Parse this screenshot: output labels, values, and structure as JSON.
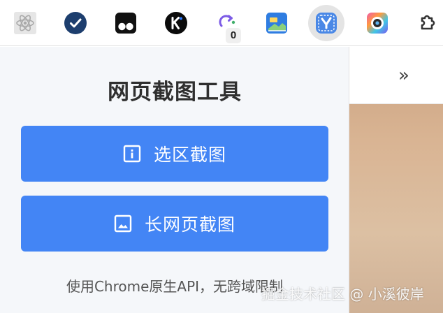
{
  "toolbar": {
    "extensions": [
      {
        "name": "react-devtools",
        "icon": "react-icon"
      },
      {
        "name": "ticktick",
        "icon": "checkmark-circle-icon"
      },
      {
        "name": "tampermonkey",
        "icon": "tampermonkey-icon"
      },
      {
        "name": "kimi",
        "icon": "kimi-k-icon"
      },
      {
        "name": "redirect",
        "icon": "redirect-arrows-icon",
        "badge": "0"
      },
      {
        "name": "image-extension",
        "icon": "landscape-icon"
      },
      {
        "name": "web-screenshot",
        "icon": "screenshot-tool-icon",
        "active": true
      },
      {
        "name": "color-picker",
        "icon": "camera-lens-icon"
      },
      {
        "name": "extensions-menu",
        "icon": "puzzle-icon"
      }
    ]
  },
  "popup": {
    "title": "网页截图工具",
    "region_button_label": "选区截图",
    "long_button_label": "长网页截图",
    "footnote": "使用Chrome原生API，无跨域限制"
  },
  "overflow_label": "»",
  "watermark": "掘金技术社区 @ 小溪彼岸",
  "colors": {
    "primary_button": "#4385f5",
    "popup_background": "#f5f7fa",
    "title_text": "#2f2f2f"
  }
}
